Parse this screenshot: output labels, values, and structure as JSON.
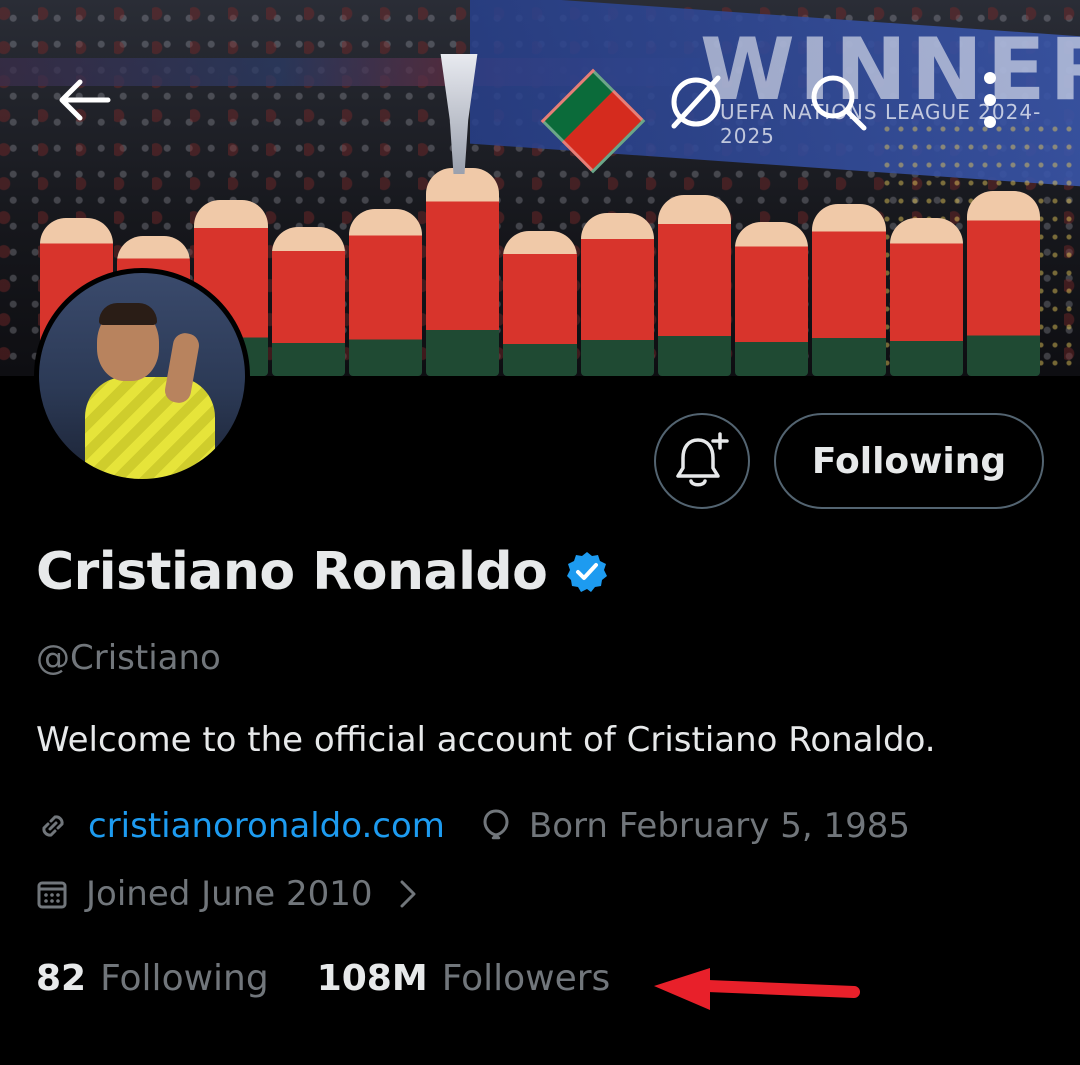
{
  "header": {
    "back_icon": "arrow-left-icon",
    "grok_icon": "grok-icon",
    "search_icon": "search-icon",
    "more_icon": "more-vertical-icon"
  },
  "banner": {
    "headline": "WINNERS",
    "subline": "UEFA NATIONS LEAGUE 2024-2025"
  },
  "actions": {
    "notify_icon": "bell-plus-icon",
    "following_label": "Following"
  },
  "profile": {
    "name": "Cristiano Ronaldo",
    "verified_icon": "verified-badge-icon",
    "handle": "@Cristiano",
    "bio": "Welcome to the official account of Cristiano Ronaldo.",
    "website": "cristianoronaldo.com",
    "birth": "Born February 5, 1985",
    "joined": "Joined June 2010"
  },
  "stats": {
    "following_count": "82",
    "following_label": "Following",
    "followers_count": "108M",
    "followers_label": "Followers"
  },
  "colors": {
    "background": "#000000",
    "text_primary": "#e7e9ea",
    "text_secondary": "#71767b",
    "link": "#1d9bf0",
    "verified": "#1d9bf0",
    "annotation_arrow": "#e8202a"
  }
}
